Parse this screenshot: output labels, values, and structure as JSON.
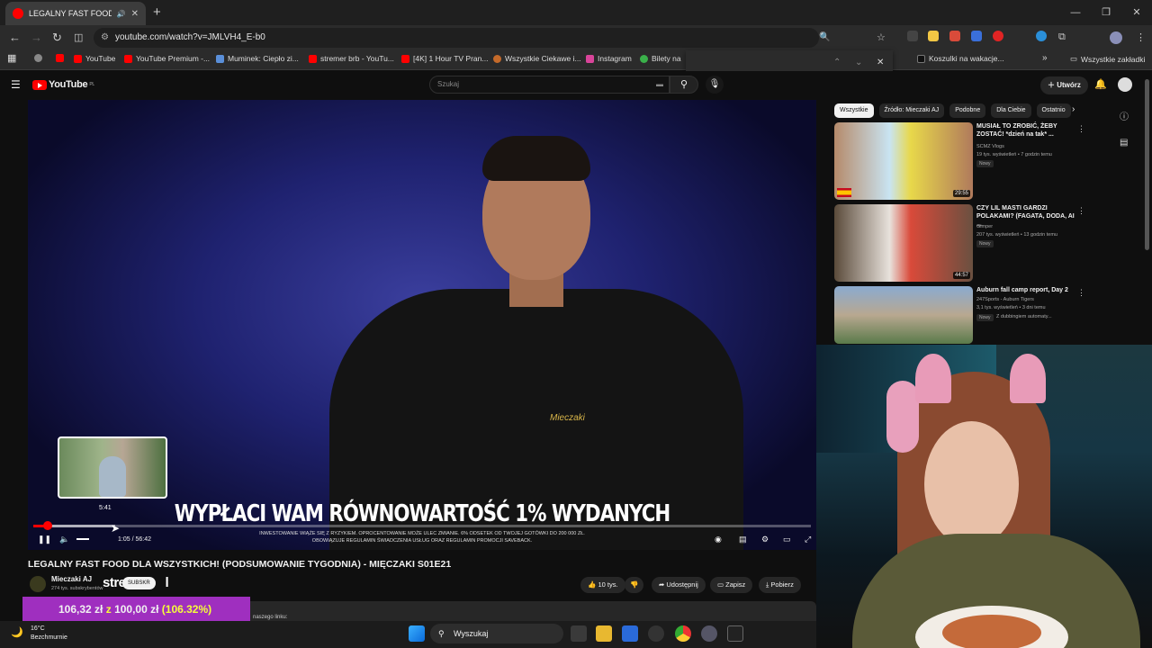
{
  "browser": {
    "tab_title": "LEGALNY FAST FOOD DLA",
    "tab_close": "✕",
    "new_tab": "+",
    "url": "youtube.com/watch?v=JMLVH4_E-b0",
    "window_controls": [
      "—",
      "❐",
      "✕"
    ],
    "nav": {
      "back": "←",
      "forward": "→",
      "reload": "↻"
    }
  },
  "bookmarks": {
    "items": [
      "YouTube",
      "YouTube Premium -...",
      "Muminek: Ciepło zi...",
      "stremer brb - YouTu...",
      "[4K] 1 Hour TV Pran...",
      "Wszystkie Ciekawe i...",
      "Instagram",
      "Bilety na",
      "Koszulki na wakacje..."
    ],
    "all_bookmarks": "Wszystkie zakładki",
    "more": "»"
  },
  "findbar": {
    "up": "⌃",
    "down": "⌄",
    "close": "✕"
  },
  "youtube": {
    "logo": "YouTube",
    "logo_region": "PL",
    "search_placeholder": "Szukaj",
    "create": "Utwórz"
  },
  "player": {
    "caption": "WYPŁACI WAM RÓWNOWARTOŚĆ 1% WYDANYCH",
    "fineprint_1": "INWESTOWANIE WIĄŻE SIĘ Z RYZYKIEM. OPROCENTOWANIE MOŻE ULEC ZMIANIE. 6% ODSETEK OD TWOJEJ GOTÓWKI DO 200 000 ZŁ.",
    "fineprint_2": "OBOWIĄZUJE REGULAMIN ŚWIADCZENIA USŁUG ORAZ REGULAMIN PROMOCJI SAVEBACK.",
    "shirt_logo": "Mieczaki",
    "preview_time": "5:41",
    "time": "1:05 / 56:42",
    "played_fraction": 0.019,
    "buffered_fraction": 0.105
  },
  "video": {
    "title": "LEGALNY FAST FOOD DLA WSZYSTKICH! (PODSUMOWANIE TYGODNIA) - MIĘCZAKI S01E21",
    "channel": "Mieczaki AJ",
    "subscribers": "274 tys. subskrybentów",
    "overlay_text": "stre",
    "overlay_text2": "l",
    "subscribe_label": "SUBSKR",
    "likes": "10 tys.",
    "share": "Udostępnij",
    "save": "Zapisz",
    "download": "Pobierz",
    "desc_snippet": "naszego linku:"
  },
  "donation": {
    "amount": "106,32 zł",
    "z": "z",
    "goal": "100,00 zł",
    "percent": "(106.32%)"
  },
  "chips": [
    "Wszystkie",
    "Źródło: Mieczaki AJ",
    "Podobne",
    "Dla Ciebie",
    "Ostatnio"
  ],
  "recommendations": [
    {
      "title": "MUSIAŁ TO ZROBIĆ, ŻEBY ZOSTAĆ! *dzień na tak* ...",
      "channel": "SCMZ Vlogs",
      "meta": "19 tys. wyświetleń • 7 godzin temu",
      "badge": "Nowy",
      "duration": "29:55"
    },
    {
      "title": "CZY LIL MASTI GARDZI POLAKAMI? (FAGATA, DODA, AI ...",
      "channel": "Gimper",
      "meta": "207 tys. wyświetleń • 13 godzin temu",
      "badge": "Nowy",
      "duration": "44:57"
    },
    {
      "title": "Auburn fall camp report, Day 2",
      "channel": "247Sports - Auburn Tigers",
      "meta": "3,1 tys. wyświetleń • 3 dni temu",
      "badge": "Nowy",
      "extra": "Z dubbingiem automaty...",
      "duration": ""
    }
  ],
  "taskbar": {
    "temperature": "16°C",
    "weather": "Bezchmurnie",
    "search": "Wyszukaj"
  },
  "colors": {
    "youtube_red": "#ff0000",
    "donation_bg": "#9f2fbf",
    "donation_highlight": "#f5ff3a"
  }
}
